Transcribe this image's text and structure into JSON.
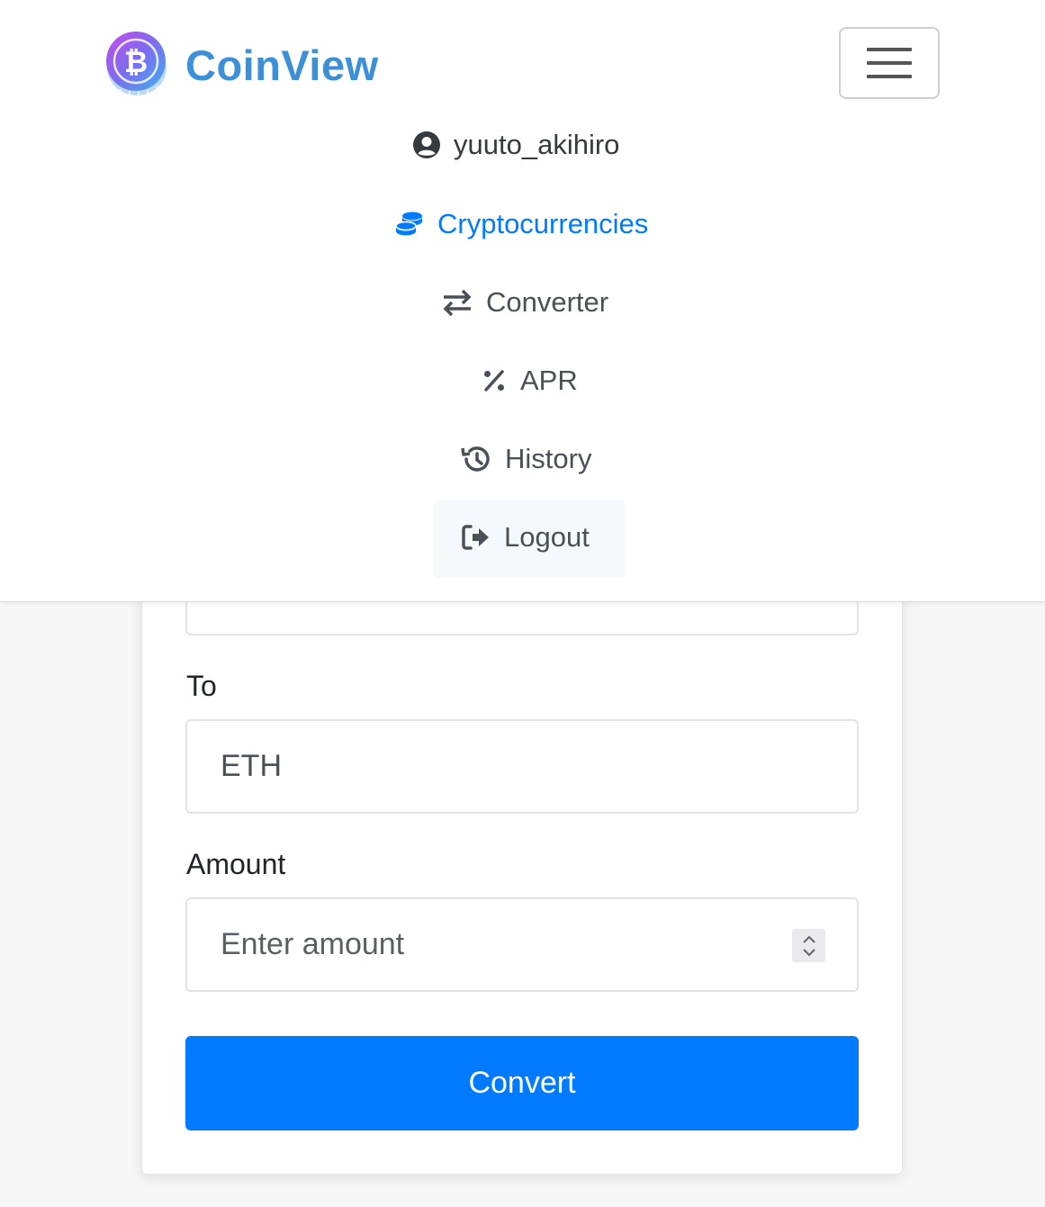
{
  "brand": {
    "name": "CoinView",
    "logo_icon": "bitcoin-coin-icon",
    "accent": "#3d8fd8"
  },
  "navbar": {
    "toggler_icon": "hamburger-menu-icon",
    "items": [
      {
        "label": "yuuto_akihiro",
        "icon": "user-circle-icon"
      },
      {
        "label": "Cryptocurrencies",
        "icon": "coins-icon",
        "active": true,
        "color": "#007bff"
      },
      {
        "label": "Converter",
        "icon": "exchange-arrows-icon"
      },
      {
        "label": "APR",
        "icon": "percent-icon"
      },
      {
        "label": "History",
        "icon": "history-icon"
      },
      {
        "label": "Logout",
        "icon": "sign-out-icon"
      }
    ]
  },
  "form": {
    "to_label": "To",
    "to_value": "ETH",
    "amount_label": "Amount",
    "amount_placeholder": "Enter amount",
    "submit_label": "Convert",
    "submit_color": "#007bff"
  }
}
